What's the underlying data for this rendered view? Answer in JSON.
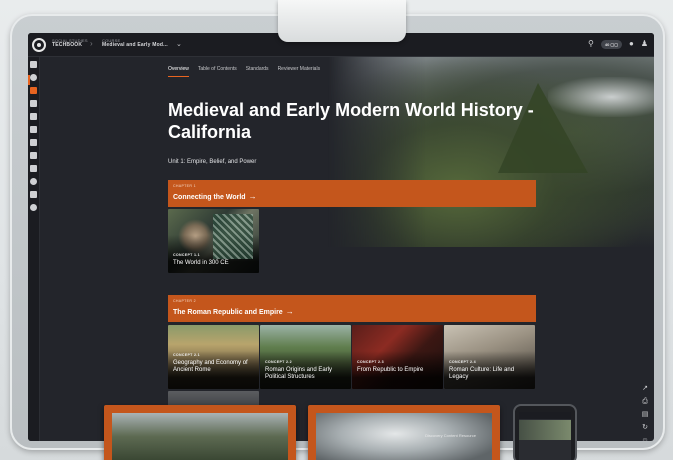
{
  "header": {
    "crumb_1_small": "SOCIAL STUDIES",
    "crumb_1_main": "TECHBOOK",
    "crumb_2_small": "COURSE",
    "crumb_2_main": "Medieval and Early Mod...",
    "badge": "40 ▢▢"
  },
  "tabs": [
    {
      "label": "Overview",
      "active": true
    },
    {
      "label": "Table of Contents",
      "active": false
    },
    {
      "label": "Standards",
      "active": false
    },
    {
      "label": "Reviewer Materials",
      "active": false
    }
  ],
  "title": "Medieval and Early Modern World History - California",
  "unit": "Unit 1: Empire, Belief, and Power",
  "chapters": [
    {
      "label": "CHAPTER 1",
      "name": "Connecting the World",
      "concepts": [
        {
          "label": "CONCEPT 1.1",
          "name": "The World in 300 CE"
        }
      ]
    },
    {
      "label": "CHAPTER 2",
      "name": "The Roman Republic and Empire",
      "concepts": [
        {
          "label": "CONCEPT 2.1",
          "name": "Geography and Economy of Ancient Rome"
        },
        {
          "label": "CONCEPT 2.2",
          "name": "Roman Origins and Early Political Structures"
        },
        {
          "label": "CONCEPT 2.3",
          "name": "From Republic to Empire"
        },
        {
          "label": "CONCEPT 2.4",
          "name": "Roman Culture: Life and Legacy"
        }
      ]
    }
  ],
  "device_watermark": "Discovery Content Resource",
  "colors": {
    "accent": "#c4561c",
    "active": "#e86420",
    "background": "#23252b"
  }
}
